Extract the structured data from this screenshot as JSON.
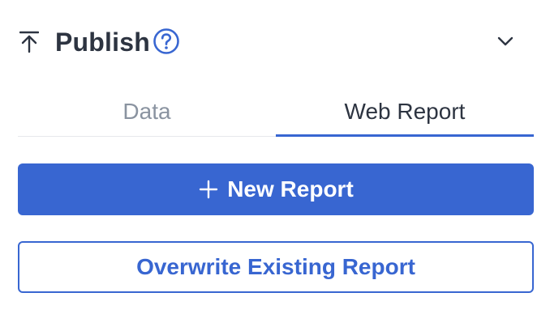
{
  "header": {
    "title": "Publish",
    "icon": "upload-arrow-icon",
    "help_icon": "question-circle-icon",
    "collapse_icon": "chevron-down-icon"
  },
  "tabs": [
    {
      "label": "Data",
      "active": false
    },
    {
      "label": "Web Report",
      "active": true
    }
  ],
  "actions": {
    "new_report_label": "New Report",
    "overwrite_label": "Overwrite Existing Report"
  },
  "colors": {
    "accent": "#3866d1",
    "text_primary": "#2d3441",
    "text_muted": "#8a93a0",
    "divider": "#e6e8ec"
  }
}
